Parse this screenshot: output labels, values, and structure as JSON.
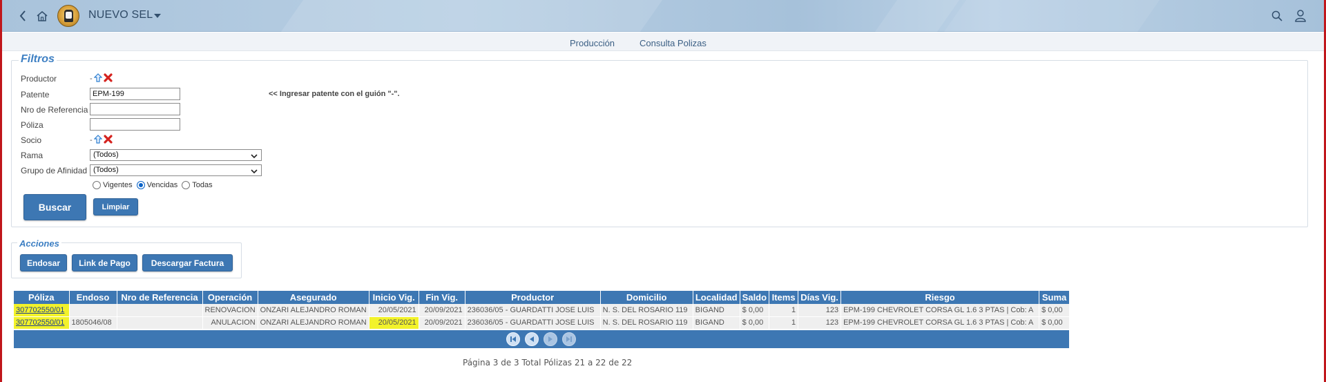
{
  "header": {
    "title": "NUEVO SEL"
  },
  "tabs": [
    "Producción",
    "Consulta Polizas"
  ],
  "filters": {
    "legend": "Filtros",
    "productor_label": "Productor",
    "productor_value": "-",
    "patente_label": "Patente",
    "patente_value": "EPM-199",
    "patente_hint": "<< Ingresar patente con el guión \"-\".",
    "nro_referencia_label": "Nro de Referencia",
    "nro_referencia_value": "",
    "poliza_label": "Póliza",
    "poliza_value": "",
    "socio_label": "Socio",
    "socio_value": "-",
    "rama_label": "Rama",
    "rama_value": "(Todos)",
    "grupo_label": "Grupo de Afinidad",
    "grupo_value": "(Todos)",
    "radio_vigentes": "Vigentes",
    "radio_vencidas": "Vencidas",
    "radio_todas": "Todas",
    "radio_selected": "Vencidas",
    "buscar": "Buscar",
    "limpiar": "Limpiar"
  },
  "actions": {
    "legend": "Acciones",
    "endosar": "Endosar",
    "link_pago": "Link de Pago",
    "descargar_factura": "Descargar Factura"
  },
  "table": {
    "columns": [
      "Póliza",
      "Endoso",
      "Nro de Referencia",
      "Operación",
      "Asegurado",
      "Inicio Vig.",
      "Fin Vig.",
      "Productor",
      "Domicilio",
      "Localidad",
      "Saldo",
      "Items",
      "Días Vig.",
      "Riesgo",
      "Suma"
    ],
    "rows": [
      [
        "307702550/01",
        "",
        "",
        "RENOVACION",
        "ONZARI ALEJANDRO ROMAN",
        "20/05/2021",
        "20/09/2021",
        "236036/05 - GUARDATTI JOSE LUIS",
        "N. S. DEL ROSARIO 119",
        "BIGAND",
        "$ 0,00",
        "1",
        "123",
        "EPM-199 CHEVROLET CORSA GL 1.6 3 PTAS | Cob: A",
        "$ 0,00"
      ],
      [
        "307702550/01",
        "1805046/08",
        "",
        "ANULACION",
        "ONZARI ALEJANDRO ROMAN",
        "20/05/2021",
        "20/09/2021",
        "236036/05 - GUARDATTI JOSE LUIS",
        "N. S. DEL ROSARIO 119",
        "BIGAND",
        "$ 0,00",
        "1",
        "123",
        "EPM-199 CHEVROLET CORSA GL 1.6 3 PTAS | Cob: A",
        "$ 0,00"
      ]
    ]
  },
  "pagination": {
    "info": "Página 3 de 3 Total Pólizas 21 a 22 de 22"
  },
  "colors": {
    "accent": "#3d77b3",
    "header_bg": "#a9c3db",
    "highlight": "#f2f22a",
    "legend": "#3d7fc3"
  },
  "icons": [
    "back-arrow-icon",
    "home-icon",
    "logo",
    "chevron-down-icon",
    "search-icon",
    "user-icon",
    "select-up-icon",
    "clear-x-icon",
    "first-page-icon",
    "prev-page-icon",
    "next-page-icon",
    "last-page-icon"
  ]
}
